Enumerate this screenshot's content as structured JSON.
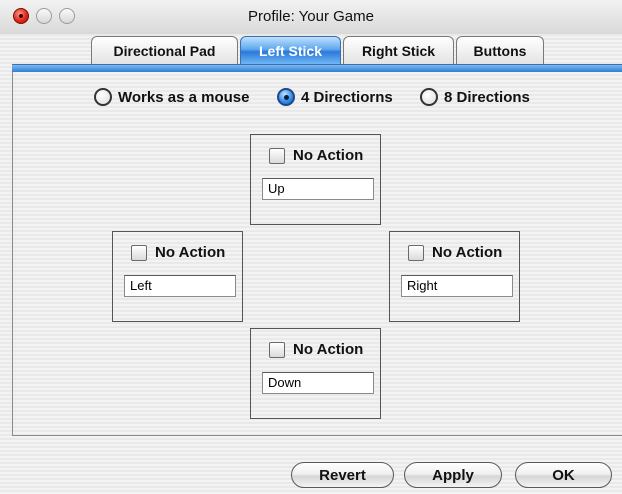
{
  "window": {
    "title": "Profile: Your Game"
  },
  "tabs": [
    {
      "label": "Directional Pad",
      "active": false
    },
    {
      "label": "Left Stick",
      "active": true
    },
    {
      "label": "Right Stick",
      "active": false
    },
    {
      "label": "Buttons",
      "active": false
    }
  ],
  "mode_options": [
    {
      "label": "Works as a mouse",
      "selected": false
    },
    {
      "label": "4 Directiorns",
      "selected": true
    },
    {
      "label": "8 Directions",
      "selected": false
    }
  ],
  "directions": {
    "up": {
      "checkbox_label": "No Action",
      "checked": false,
      "value": "Up"
    },
    "left": {
      "checkbox_label": "No Action",
      "checked": false,
      "value": "Left"
    },
    "right": {
      "checkbox_label": "No Action",
      "checked": false,
      "value": "Right"
    },
    "down": {
      "checkbox_label": "No Action",
      "checked": false,
      "value": "Down"
    }
  },
  "buttons": {
    "revert": "Revert",
    "apply": "Apply",
    "ok": "OK"
  },
  "colors": {
    "accent_blue": "#2f7fd6",
    "close_red": "#e0281a"
  }
}
